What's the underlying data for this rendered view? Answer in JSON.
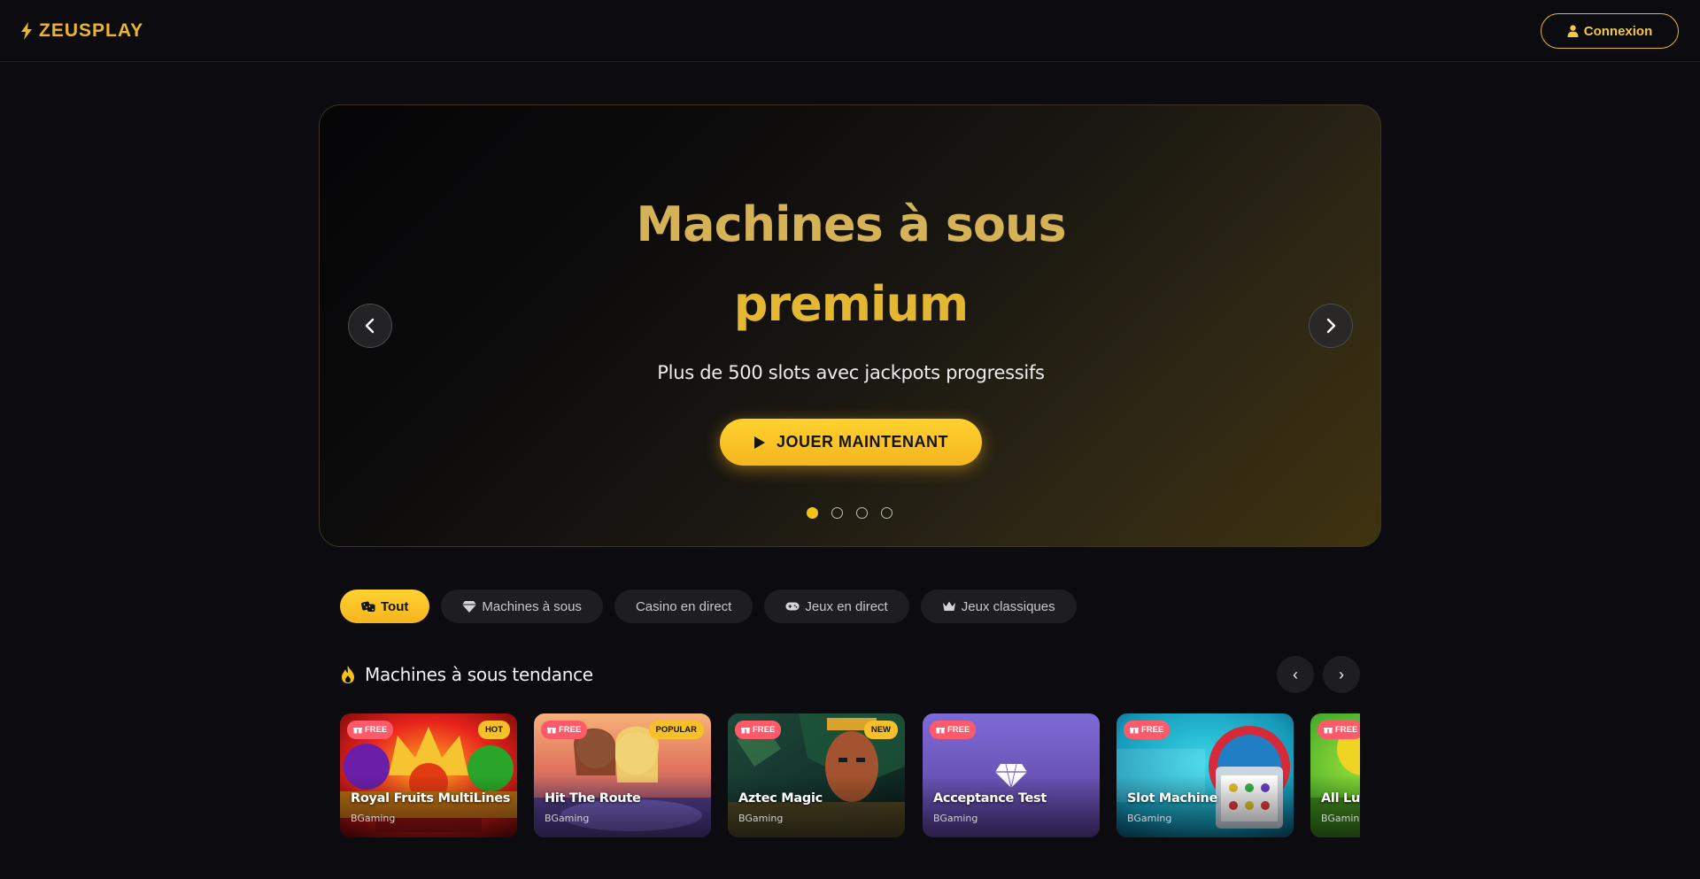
{
  "header": {
    "brand": "ZEUSPLAY",
    "login_label": "Connexion"
  },
  "hero": {
    "title_line1": "Machines à sous",
    "title_line2": "premium",
    "subtitle": "Plus de 500 slots avec jackpots progressifs",
    "cta_label": "JOUER MAINTENANT",
    "slides_count": 4,
    "active_slide": 1
  },
  "filters": [
    {
      "label": "Tout",
      "icon": "dice-icon",
      "active": true
    },
    {
      "label": "Machines à sous",
      "icon": "gem-icon",
      "active": false
    },
    {
      "label": "Casino en direct",
      "icon": "",
      "active": false
    },
    {
      "label": "Jeux en direct",
      "icon": "gamepad-icon",
      "active": false
    },
    {
      "label": "Jeux classiques",
      "icon": "crown-icon",
      "active": false
    }
  ],
  "trending": {
    "title": "Machines à sous tendance",
    "icon": "fire-icon",
    "prev": "‹",
    "next": "›",
    "games": [
      {
        "name": "Royal Fruits MultiLines",
        "provider": "BGaming",
        "free": "FREE",
        "tag": "HOT"
      },
      {
        "name": "Hit The Route",
        "provider": "BGaming",
        "free": "FREE",
        "tag": "POPULAR"
      },
      {
        "name": "Aztec Magic",
        "provider": "BGaming",
        "free": "FREE",
        "tag": "NEW"
      },
      {
        "name": "Acceptance Test",
        "provider": "BGaming",
        "free": "FREE",
        "tag": ""
      },
      {
        "name": "Slot Machine",
        "provider": "BGaming",
        "free": "FREE",
        "tag": ""
      },
      {
        "name": "All Luc",
        "provider": "BGaming",
        "free": "FREE",
        "tag": ""
      }
    ]
  },
  "colors": {
    "accent": "#f5c21b",
    "brand": "#e9b62c",
    "background": "#0b0b10",
    "chip_bg": "#1d1d22",
    "free_badge": "#ff5a6a"
  }
}
